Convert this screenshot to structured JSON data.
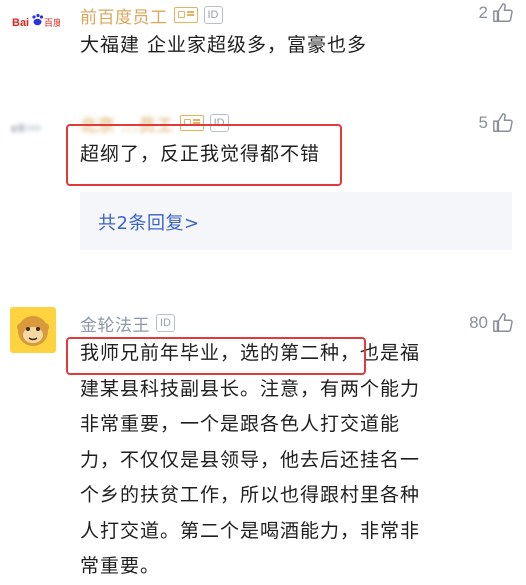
{
  "comments": [
    {
      "avatar_text": "Bai百度",
      "username": "前百度员工",
      "id_badge": "ID",
      "likes": "2",
      "text": "大福建 企业家超级多，富豪也多"
    },
    {
      "username": "北京 ...员工",
      "id_badge": "ID",
      "likes": "5",
      "text": "超纲了，反正我觉得都不错",
      "replies_link": "共2条回复>"
    },
    {
      "username": "金轮法王",
      "id_badge": "ID",
      "likes": "80",
      "text_lines": [
        "我师兄前年毕业，选的第二种，也是福",
        "建某县科技副县长。注意，有两个能力",
        "非常重要，一个是跟各色人打交道能",
        "力，不仅仅是县领导，他去后还挂名一",
        "个乡的扶贫工作，所以也得跟村里各种",
        "人打交道。第二个是喝酒能力，非常非",
        "常重要。"
      ]
    }
  ],
  "colors": {
    "employee_name": "#d8a75a",
    "highlight_box": "#e03a3a",
    "reply_link": "#3b63c9",
    "baidu_red": "#e1251b",
    "baidu_blue": "#2932e1"
  }
}
